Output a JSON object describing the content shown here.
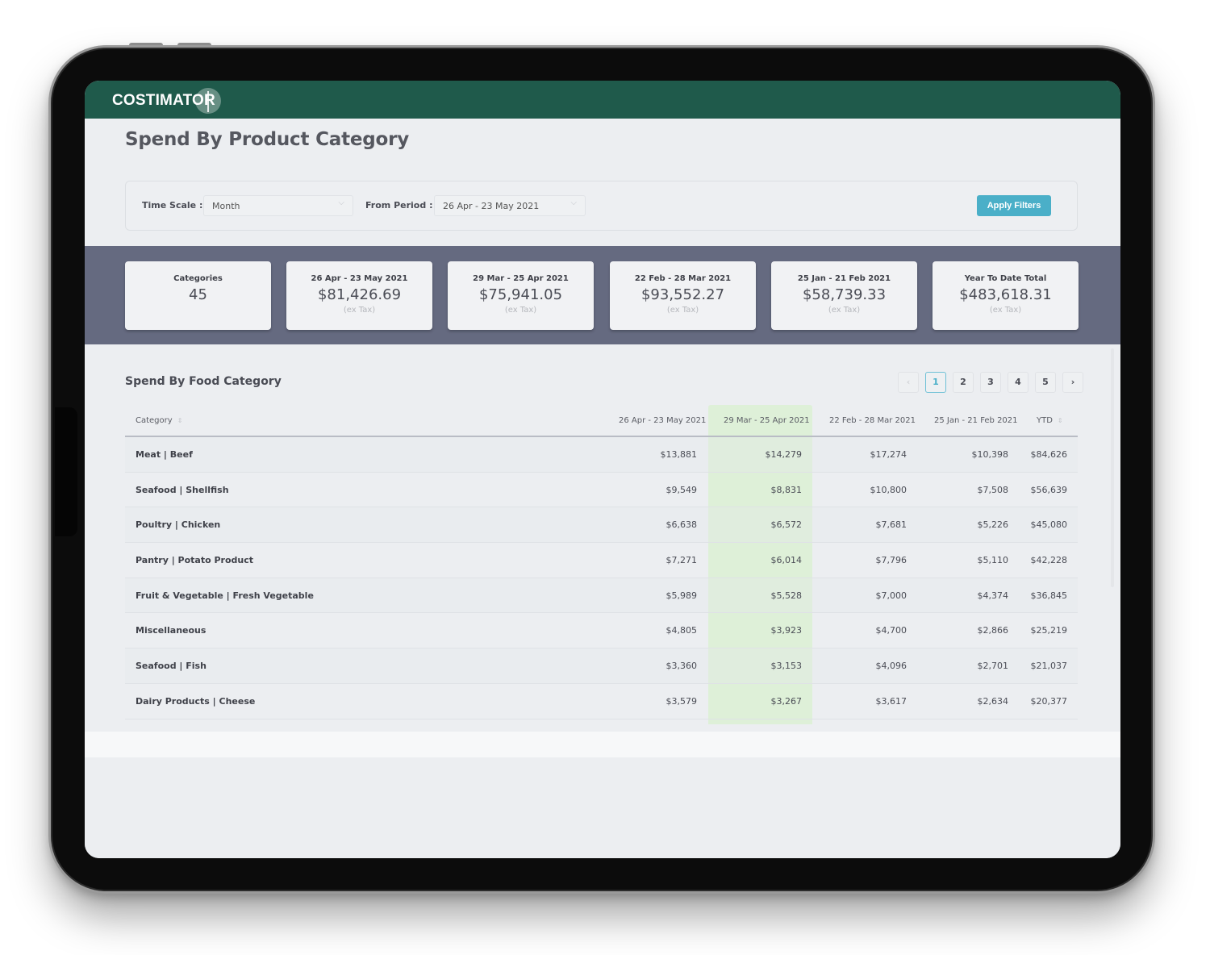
{
  "app": {
    "brand": "COSTIMATOR",
    "page_title": "Spend By Product Category",
    "colors": {
      "topbar": "#1f5a4b",
      "accent": "#4aafc8",
      "summary_band": "#656a80",
      "highlight_column": "#def0d8"
    }
  },
  "filters": {
    "time_scale_label": "Time Scale :",
    "time_scale_value": "Month",
    "from_period_label": "From Period :",
    "from_period_value": "26 Apr - 23 May 2021",
    "apply_label": "Apply Filters"
  },
  "summary_cards": [
    {
      "label": "Categories",
      "value": "45",
      "sub": ""
    },
    {
      "label": "26 Apr - 23 May 2021",
      "value": "$81,426.69",
      "sub": "(ex Tax)"
    },
    {
      "label": "29 Mar - 25 Apr 2021",
      "value": "$75,941.05",
      "sub": "(ex Tax)"
    },
    {
      "label": "22 Feb - 28 Mar 2021",
      "value": "$93,552.27",
      "sub": "(ex Tax)"
    },
    {
      "label": "25 Jan - 21 Feb 2021",
      "value": "$58,739.33",
      "sub": "(ex Tax)"
    },
    {
      "label": "Year To Date Total",
      "value": "$483,618.31",
      "sub": "(ex Tax)"
    }
  ],
  "table": {
    "title": "Spend By Food Category",
    "pagination": {
      "prev": "‹",
      "next": "›",
      "pages": [
        "1",
        "2",
        "3",
        "4",
        "5"
      ],
      "current": "1"
    },
    "columns": [
      "Category",
      "26 Apr - 23 May 2021",
      "29 Mar - 25 Apr 2021",
      "22 Feb - 28 Mar 2021",
      "25 Jan - 21 Feb 2021",
      "YTD"
    ],
    "highlighted_column": "29 Mar - 25 Apr 2021",
    "rows": [
      {
        "category": "Meat | Beef",
        "c1": "$13,881",
        "c2": "$14,279",
        "c3": "$17,274",
        "c4": "$10,398",
        "ytd": "$84,626"
      },
      {
        "category": "Seafood | Shellfish",
        "c1": "$9,549",
        "c2": "$8,831",
        "c3": "$10,800",
        "c4": "$7,508",
        "ytd": "$56,639"
      },
      {
        "category": "Poultry | Chicken",
        "c1": "$6,638",
        "c2": "$6,572",
        "c3": "$7,681",
        "c4": "$5,226",
        "ytd": "$45,080"
      },
      {
        "category": "Pantry | Potato Product",
        "c1": "$7,271",
        "c2": "$6,014",
        "c3": "$7,796",
        "c4": "$5,110",
        "ytd": "$42,228"
      },
      {
        "category": "Fruit & Vegetable | Fresh Vegetable",
        "c1": "$5,989",
        "c2": "$5,528",
        "c3": "$7,000",
        "c4": "$4,374",
        "ytd": "$36,845"
      },
      {
        "category": "Miscellaneous",
        "c1": "$4,805",
        "c2": "$3,923",
        "c3": "$4,700",
        "c4": "$2,866",
        "ytd": "$25,219"
      },
      {
        "category": "Seafood | Fish",
        "c1": "$3,360",
        "c2": "$3,153",
        "c3": "$4,096",
        "c4": "$2,701",
        "ytd": "$21,037"
      },
      {
        "category": "Dairy Products | Cheese",
        "c1": "$3,579",
        "c2": "$3,267",
        "c3": "$3,617",
        "c4": "$2,634",
        "ytd": "$20,377"
      }
    ]
  },
  "icons": {
    "chevron_down": "⌵",
    "sort": "⇕"
  }
}
